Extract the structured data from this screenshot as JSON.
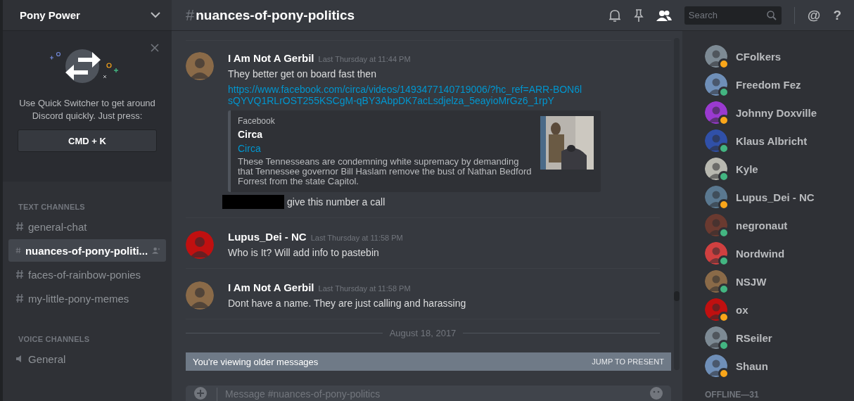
{
  "server": {
    "name": "Pony Power"
  },
  "quick_switcher": {
    "text": "Use Quick Switcher to get around Discord quickly. Just press:",
    "shortcut": "CMD + K"
  },
  "channel_groups": [
    {
      "title": "TEXT CHANNELS",
      "kind": "text",
      "channels": [
        {
          "name": "general-chat",
          "selected": false
        },
        {
          "name": "nuances-of-pony-politi...",
          "selected": true
        },
        {
          "name": "faces-of-rainbow-ponies",
          "selected": false
        },
        {
          "name": "my-little-pony-memes",
          "selected": false
        }
      ]
    },
    {
      "title": "VOICE CHANNELS",
      "kind": "voice",
      "channels": [
        {
          "name": "General",
          "selected": false
        }
      ]
    }
  ],
  "header": {
    "hash": "#",
    "channel": "nuances-of-pony-politics",
    "search_placeholder": "Search",
    "help": "?",
    "mention": "@"
  },
  "messages": [
    {
      "author": "I Am Not A Gerbil",
      "time": "Last Thursday at 11:44 PM",
      "lines": [
        {
          "kind": "text",
          "text": "They better get on board fast then"
        },
        {
          "kind": "link",
          "text": "https://www.facebook.com/circa/videos/1493477140719006/?hc_ref=ARR-BON6lsQYVQ1RLrOST255KSCgM-qBY3AbpDK7acLsdjelza_5eayioMrGz6_1rpY"
        },
        {
          "kind": "embed",
          "provider": "Facebook",
          "title": "Circa",
          "author": "Circa",
          "description": "These Tennesseans are condemning white supremacy by demanding that Tennessee governor Bill Haslam remove the bust of Nathan Bedford Forrest from the state Capitol."
        },
        {
          "kind": "redacted",
          "text": "give this number a call"
        }
      ]
    },
    {
      "author": "Lupus_Dei - NC",
      "time": "Last Thursday at 11:58 PM",
      "lines": [
        {
          "kind": "text",
          "text": "Who is It? Will add info to pastebin"
        }
      ]
    },
    {
      "author": "I Am Not A Gerbil",
      "time": "Last Thursday at 11:58 PM",
      "lines": [
        {
          "kind": "text",
          "text": "Dont have a name. They are just calling and harassing"
        }
      ]
    }
  ],
  "date_divider": "August 18, 2017",
  "older_bar": {
    "text": "You're viewing older messages",
    "action": "JUMP TO PRESENT"
  },
  "composer": {
    "placeholder": "Message #nuances-of-pony-politics"
  },
  "members": [
    {
      "name": "CFolkers",
      "color": "#faa61a"
    },
    {
      "name": "Freedom Fez",
      "color": "#43b581"
    },
    {
      "name": "Johnny Doxville",
      "color": "#faa61a"
    },
    {
      "name": "Klaus Albricht",
      "color": "#43b581"
    },
    {
      "name": "Kyle",
      "color": "#43b581"
    },
    {
      "name": "Lupus_Dei - NC",
      "color": "#faa61a"
    },
    {
      "name": "negronaut",
      "color": "#43b581"
    },
    {
      "name": "Nordwind",
      "color": "#43b581"
    },
    {
      "name": "NSJW",
      "color": "#43b581"
    },
    {
      "name": "ox",
      "color": "#faa61a"
    },
    {
      "name": "RSeiler",
      "color": "#43b581"
    },
    {
      "name": "Shaun",
      "color": "#faa61a"
    }
  ],
  "offline_header": "OFFLINE—31"
}
